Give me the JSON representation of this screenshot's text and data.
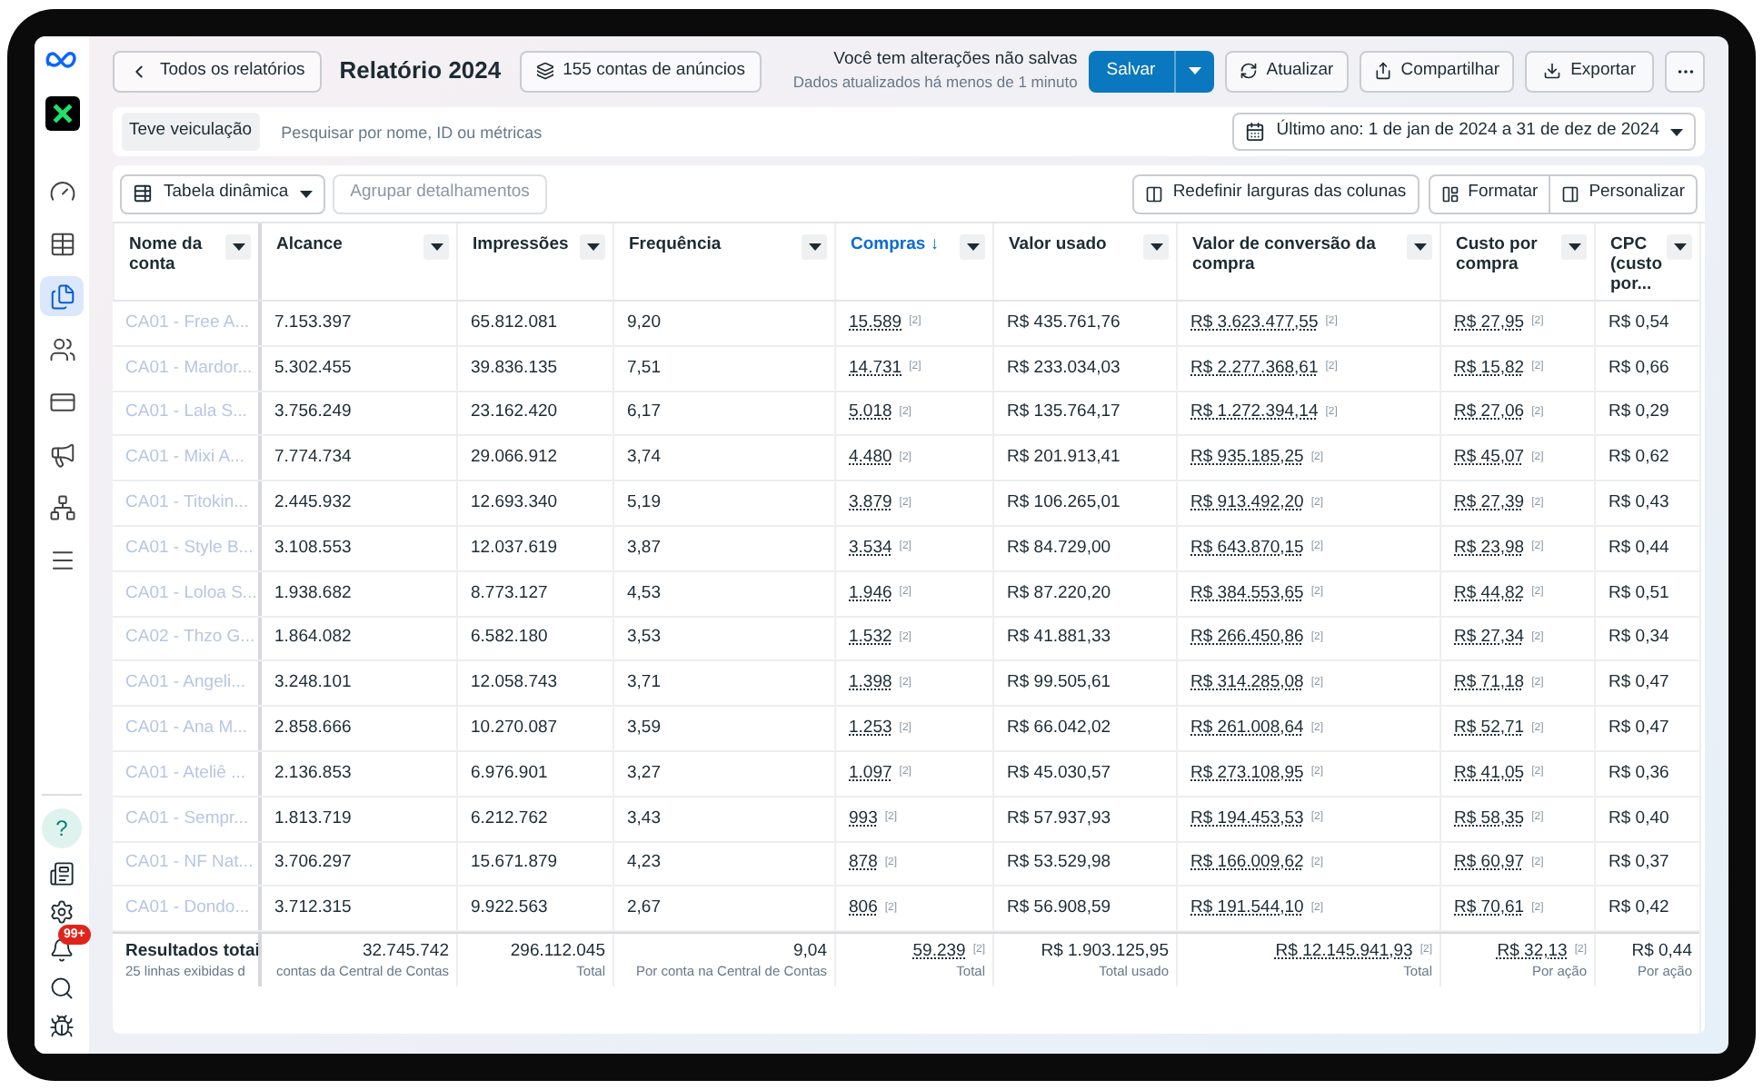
{
  "sidebar": {
    "items": [
      {
        "selected": false
      },
      {
        "selected": false
      },
      {
        "selected": true
      },
      {
        "selected": false
      },
      {
        "selected": false
      },
      {
        "selected": false
      },
      {
        "selected": false
      },
      {
        "selected": false
      }
    ],
    "help": "?",
    "notifications_badge": "99+"
  },
  "header": {
    "back": "Todos os relatórios",
    "title": "Relatório 2024",
    "accounts": "155 contas de anúncios",
    "status": "Você tem alterações não salvas",
    "updated": "Dados atualizados há menos de 1 minuto",
    "save": "Salvar",
    "refresh": "Atualizar",
    "share": "Compartilhar",
    "export": "Exportar"
  },
  "filter": {
    "chip": "Teve veiculação",
    "placeholder": "Pesquisar por nome, ID ou métricas",
    "date_range": "Último ano: 1 de jan de 2024 a 31 de dez de 2024"
  },
  "table_toolbar": {
    "view": "Tabela dinâmica",
    "group": "Agrupar detalhamentos",
    "reset_widths": "Redefinir larguras das colunas",
    "format": "Formatar",
    "customize": "Personalizar"
  },
  "table": {
    "columns": [
      {
        "label": "Nome da conta",
        "sorted": false
      },
      {
        "label": "Alcance",
        "sorted": false
      },
      {
        "label": "Impressões",
        "sorted": false
      },
      {
        "label": "Frequência",
        "sorted": false
      },
      {
        "label": "Compras ↓",
        "sorted": true
      },
      {
        "label": "Valor usado",
        "sorted": false
      },
      {
        "label": "Valor de conversão da compra",
        "sorted": false
      },
      {
        "label": "Custo por compra",
        "sorted": false
      },
      {
        "label": "CPC (custo por...",
        "sorted": false
      }
    ],
    "rows": [
      {
        "cells": [
          "CA01 - Free A...",
          "7.153.397",
          "65.812.081",
          "9,20",
          {
            "text": "15.589",
            "note": "[2]"
          },
          "R$ 435.761,76",
          {
            "text": "R$ 3.623.477,55",
            "note": "[2]"
          },
          {
            "text": "R$ 27,95",
            "note": "[2]"
          },
          "R$ 0,54"
        ]
      },
      {
        "cells": [
          "CA01 - Mardor...",
          "5.302.455",
          "39.836.135",
          "7,51",
          {
            "text": "14.731",
            "note": "[2]"
          },
          "R$ 233.034,03",
          {
            "text": "R$ 2.277.368,61",
            "note": "[2]"
          },
          {
            "text": "R$ 15,82",
            "note": "[2]"
          },
          "R$ 0,66"
        ]
      },
      {
        "cells": [
          "CA01 - Lala S...",
          "3.756.249",
          "23.162.420",
          "6,17",
          {
            "text": "5.018",
            "note": "[2]"
          },
          "R$ 135.764,17",
          {
            "text": "R$ 1.272.394,14",
            "note": "[2]"
          },
          {
            "text": "R$ 27,06",
            "note": "[2]"
          },
          "R$ 0,29"
        ]
      },
      {
        "cells": [
          "CA01 - Mixi A...",
          "7.774.734",
          "29.066.912",
          "3,74",
          {
            "text": "4.480",
            "note": "[2]"
          },
          "R$ 201.913,41",
          {
            "text": "R$ 935.185,25",
            "note": "[2]"
          },
          {
            "text": "R$ 45,07",
            "note": "[2]"
          },
          "R$ 0,62"
        ]
      },
      {
        "cells": [
          "CA01 - Titokin...",
          "2.445.932",
          "12.693.340",
          "5,19",
          {
            "text": "3.879",
            "note": "[2]"
          },
          "R$ 106.265,01",
          {
            "text": "R$ 913.492,20",
            "note": "[2]"
          },
          {
            "text": "R$ 27,39",
            "note": "[2]"
          },
          "R$ 0,43"
        ]
      },
      {
        "cells": [
          "CA01 - Style B...",
          "3.108.553",
          "12.037.619",
          "3,87",
          {
            "text": "3.534",
            "note": "[2]"
          },
          "R$ 84.729,00",
          {
            "text": "R$ 643.870,15",
            "note": "[2]"
          },
          {
            "text": "R$ 23,98",
            "note": "[2]"
          },
          "R$ 0,44"
        ]
      },
      {
        "cells": [
          "CA01 - Loloa S...",
          "1.938.682",
          "8.773.127",
          "4,53",
          {
            "text": "1.946",
            "note": "[2]"
          },
          "R$ 87.220,20",
          {
            "text": "R$ 384.553,65",
            "note": "[2]"
          },
          {
            "text": "R$ 44,82",
            "note": "[2]"
          },
          "R$ 0,51"
        ]
      },
      {
        "cells": [
          "CA02 - Thzo G...",
          "1.864.082",
          "6.582.180",
          "3,53",
          {
            "text": "1.532",
            "note": "[2]"
          },
          "R$ 41.881,33",
          {
            "text": "R$ 266.450,86",
            "note": "[2]"
          },
          {
            "text": "R$ 27,34",
            "note": "[2]"
          },
          "R$ 0,34"
        ]
      },
      {
        "cells": [
          "CA01 - Angeli...",
          "3.248.101",
          "12.058.743",
          "3,71",
          {
            "text": "1.398",
            "note": "[2]"
          },
          "R$ 99.505,61",
          {
            "text": "R$ 314.285,08",
            "note": "[2]"
          },
          {
            "text": "R$ 71,18",
            "note": "[2]"
          },
          "R$ 0,47"
        ]
      },
      {
        "cells": [
          "CA01 - Ana M...",
          "2.858.666",
          "10.270.087",
          "3,59",
          {
            "text": "1.253",
            "note": "[2]"
          },
          "R$ 66.042,02",
          {
            "text": "R$ 261.008,64",
            "note": "[2]"
          },
          {
            "text": "R$ 52,71",
            "note": "[2]"
          },
          "R$ 0,47"
        ]
      },
      {
        "cells": [
          "CA01 - Ateliê ...",
          "2.136.853",
          "6.976.901",
          "3,27",
          {
            "text": "1.097",
            "note": "[2]"
          },
          "R$ 45.030,57",
          {
            "text": "R$ 273.108,95",
            "note": "[2]"
          },
          {
            "text": "R$ 41,05",
            "note": "[2]"
          },
          "R$ 0,36"
        ]
      },
      {
        "cells": [
          "CA01 - Sempr...",
          "1.813.719",
          "6.212.762",
          "3,43",
          {
            "text": "993",
            "note": "[2]"
          },
          "R$ 57.937,93",
          {
            "text": "R$ 194.453,53",
            "note": "[2]"
          },
          {
            "text": "R$ 58,35",
            "note": "[2]"
          },
          "R$ 0,40"
        ]
      },
      {
        "cells": [
          "CA01 - NF Nat...",
          "3.706.297",
          "15.671.879",
          "4,23",
          {
            "text": "878",
            "note": "[2]"
          },
          "R$ 53.529,98",
          {
            "text": "R$ 166.009,62",
            "note": "[2]"
          },
          {
            "text": "R$ 60,97",
            "note": "[2]"
          },
          "R$ 0,37"
        ]
      },
      {
        "cells": [
          "CA01 - Dondo...",
          "3.712.315",
          "9.922.563",
          "2,67",
          {
            "text": "806",
            "note": "[2]"
          },
          "R$ 56.908,59",
          {
            "text": "R$ 191.544,10",
            "note": "[2]"
          },
          {
            "text": "R$ 70,61",
            "note": "[2]"
          },
          "R$ 0,42"
        ]
      }
    ],
    "totals": {
      "title": "Resultados totai",
      "subtitle": "25 linhas exibidas d",
      "cells": [
        {
          "value": "32.745.742",
          "caption": "contas da Central de Contas"
        },
        {
          "value": "296.112.045",
          "caption": "Total"
        },
        {
          "value": "9,04",
          "caption": "Por conta na Central de Contas"
        },
        {
          "value": "59.239",
          "note": "[2]",
          "caption": "Total"
        },
        {
          "value": "R$ 1.903.125,95",
          "caption": "Total usado"
        },
        {
          "value": "R$ 12.145.941,93",
          "note": "[2]",
          "caption": "Total"
        },
        {
          "value": "R$ 32,13",
          "note": "[2]",
          "caption": "Por ação"
        },
        {
          "value": "R$ 0,44",
          "caption": "Por ação"
        }
      ]
    }
  }
}
